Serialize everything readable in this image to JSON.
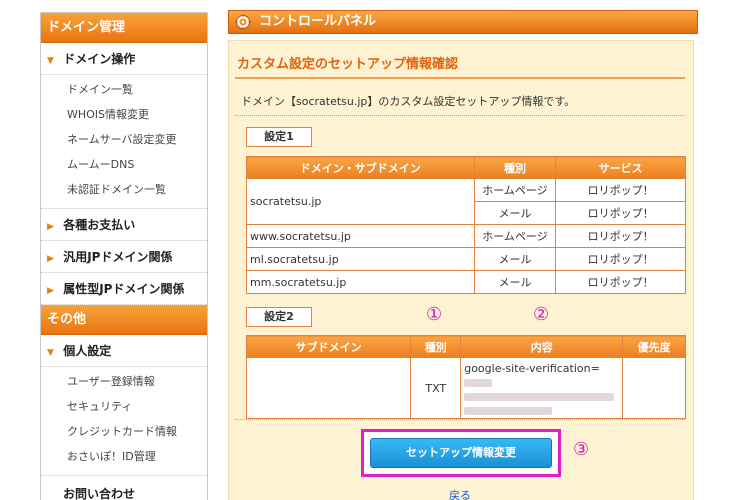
{
  "sidebar": {
    "domain_header": "ドメイン管理",
    "domain_ops": {
      "label": "ドメイン操作",
      "items": [
        "ドメイン一覧",
        "WHOIS情報変更",
        "ネームサーバ設定変更",
        "ムームーDNS",
        "未認証ドメイン一覧"
      ]
    },
    "payments": "各種お支払い",
    "general_jp": "汎用JPドメイン関係",
    "attr_jp": "属性型JPドメイン関係",
    "other_header": "その他",
    "personal": {
      "label": "個人設定",
      "items": [
        "ユーザー登録情報",
        "セキュリティ",
        "クレジットカード情報",
        "おさいぽ！ID管理"
      ]
    },
    "contact": "お問い合わせ"
  },
  "panel": {
    "title": "コントロールパネル"
  },
  "main": {
    "title": "カスタム設定のセットアップ情報確認",
    "intro": "ドメイン【socratetsu.jp】のカスタム設定セットアップ情報です。",
    "setting1": {
      "label": "設定1",
      "headers": [
        "ドメイン・サブドメイン",
        "種別",
        "サービス"
      ],
      "rows": [
        {
          "domain": "socratetsu.jp",
          "type": "ホームページ",
          "service": "ロリポップ！"
        },
        {
          "domain": "",
          "type": "メール",
          "service": "ロリポップ！"
        },
        {
          "domain": "www.socratetsu.jp",
          "type": "ホームページ",
          "service": "ロリポップ！"
        },
        {
          "domain": "ml.socratetsu.jp",
          "type": "メール",
          "service": "ロリポップ！"
        },
        {
          "domain": "mm.socratetsu.jp",
          "type": "メール",
          "service": "ロリポップ！"
        }
      ]
    },
    "setting2": {
      "label": "設定2",
      "headers": [
        "サブドメイン",
        "種別",
        "内容",
        "優先度"
      ],
      "row": {
        "subdomain": "",
        "type": "TXT",
        "content": "google-site-verification=",
        "priority": ""
      }
    },
    "markers": [
      "①",
      "②",
      "③"
    ],
    "submit_label": "セットアップ情報変更",
    "back_label": "戻る"
  },
  "colors": {
    "accent_orange": "#e8820f",
    "highlight_magenta": "#e021c7",
    "button_blue": "#1b8fd6"
  }
}
